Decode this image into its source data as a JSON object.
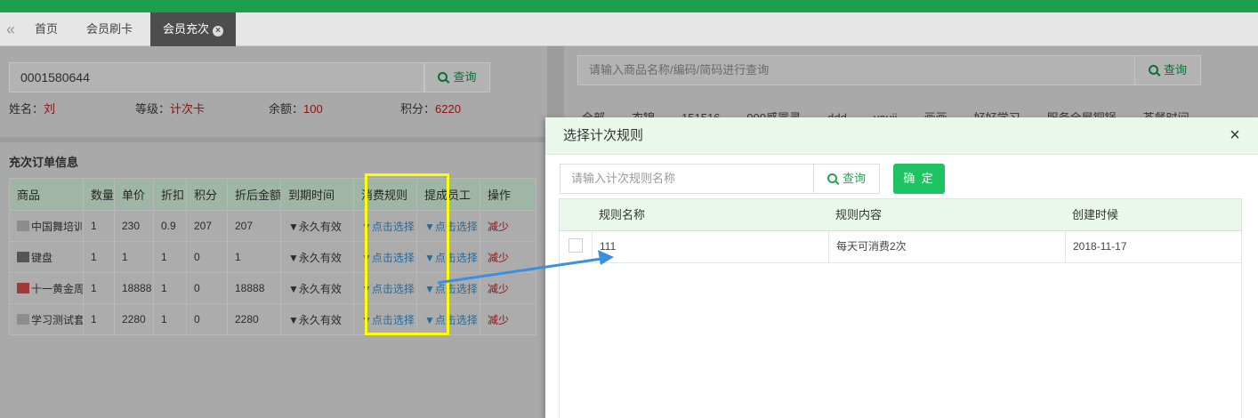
{
  "tabs": {
    "home": "首页",
    "member_card": "会员刷卡",
    "member_recharge": "会员充次"
  },
  "left": {
    "card_number": "0001580644",
    "search_label": "查询",
    "info": {
      "name_label": "姓名：",
      "name_value": "刘",
      "level_label": "等级：",
      "level_value": "计次卡",
      "balance_label": "余额：",
      "balance_value": "100",
      "points_label": "积分：",
      "points_value": "6220"
    },
    "order_title": "充次订单信息",
    "columns": [
      "商品",
      "数量",
      "单价",
      "折扣",
      "积分",
      "折后金额",
      "到期时间",
      "消费规则",
      "提成员工",
      "操作"
    ],
    "rows": [
      {
        "product": "中国舞培训",
        "qty": "1",
        "price": "230",
        "discount": "0.9",
        "points": "207",
        "amount": "207",
        "expiry": "▼永久有效",
        "rule": "▼点击选择",
        "staff": "▼点击选择",
        "op": "减少"
      },
      {
        "product": "键盘",
        "qty": "1",
        "price": "1",
        "discount": "1",
        "points": "0",
        "amount": "1",
        "expiry": "▼永久有效",
        "rule": "▼点击选择",
        "staff": "▼点击选择",
        "op": "减少"
      },
      {
        "product": "十一黄金周",
        "qty": "1",
        "price": "18888",
        "discount": "1",
        "points": "0",
        "amount": "18888",
        "expiry": "▼永久有效",
        "rule": "▼点击选择",
        "staff": "▼点击选择",
        "op": "减少"
      },
      {
        "product": "学习测试套",
        "qty": "1",
        "price": "2280",
        "discount": "1",
        "points": "0",
        "amount": "2280",
        "expiry": "▼永久有效",
        "rule": "▼点击选择",
        "staff": "▼点击选择",
        "op": "减少"
      }
    ]
  },
  "right": {
    "search_placeholder": "请输入商品名称/编码/简码进行查询",
    "search_label": "查询",
    "categories": [
      "全部",
      "衣锦",
      "151516",
      "999感冒灵",
      "ddd",
      "yauii",
      "画画",
      "好好学习",
      "服务全屋铜锅",
      "茶餐时间"
    ]
  },
  "modal": {
    "title": "选择计次规则",
    "close": "×",
    "search_placeholder": "请输入计次规则名称",
    "search_label": "查询",
    "confirm_label": "确 定",
    "columns": {
      "name": "规则名称",
      "content": "规则内容",
      "created": "创建时候"
    },
    "rows": [
      {
        "name": "111",
        "content": "每天可消费2次",
        "created": "2018-11-17"
      }
    ]
  },
  "colors": {
    "brand_green": "#1e9d4d",
    "confirm_green": "#1fc362",
    "highlight_yellow": "#ffff00",
    "arrow_blue": "#3b8fe0"
  }
}
